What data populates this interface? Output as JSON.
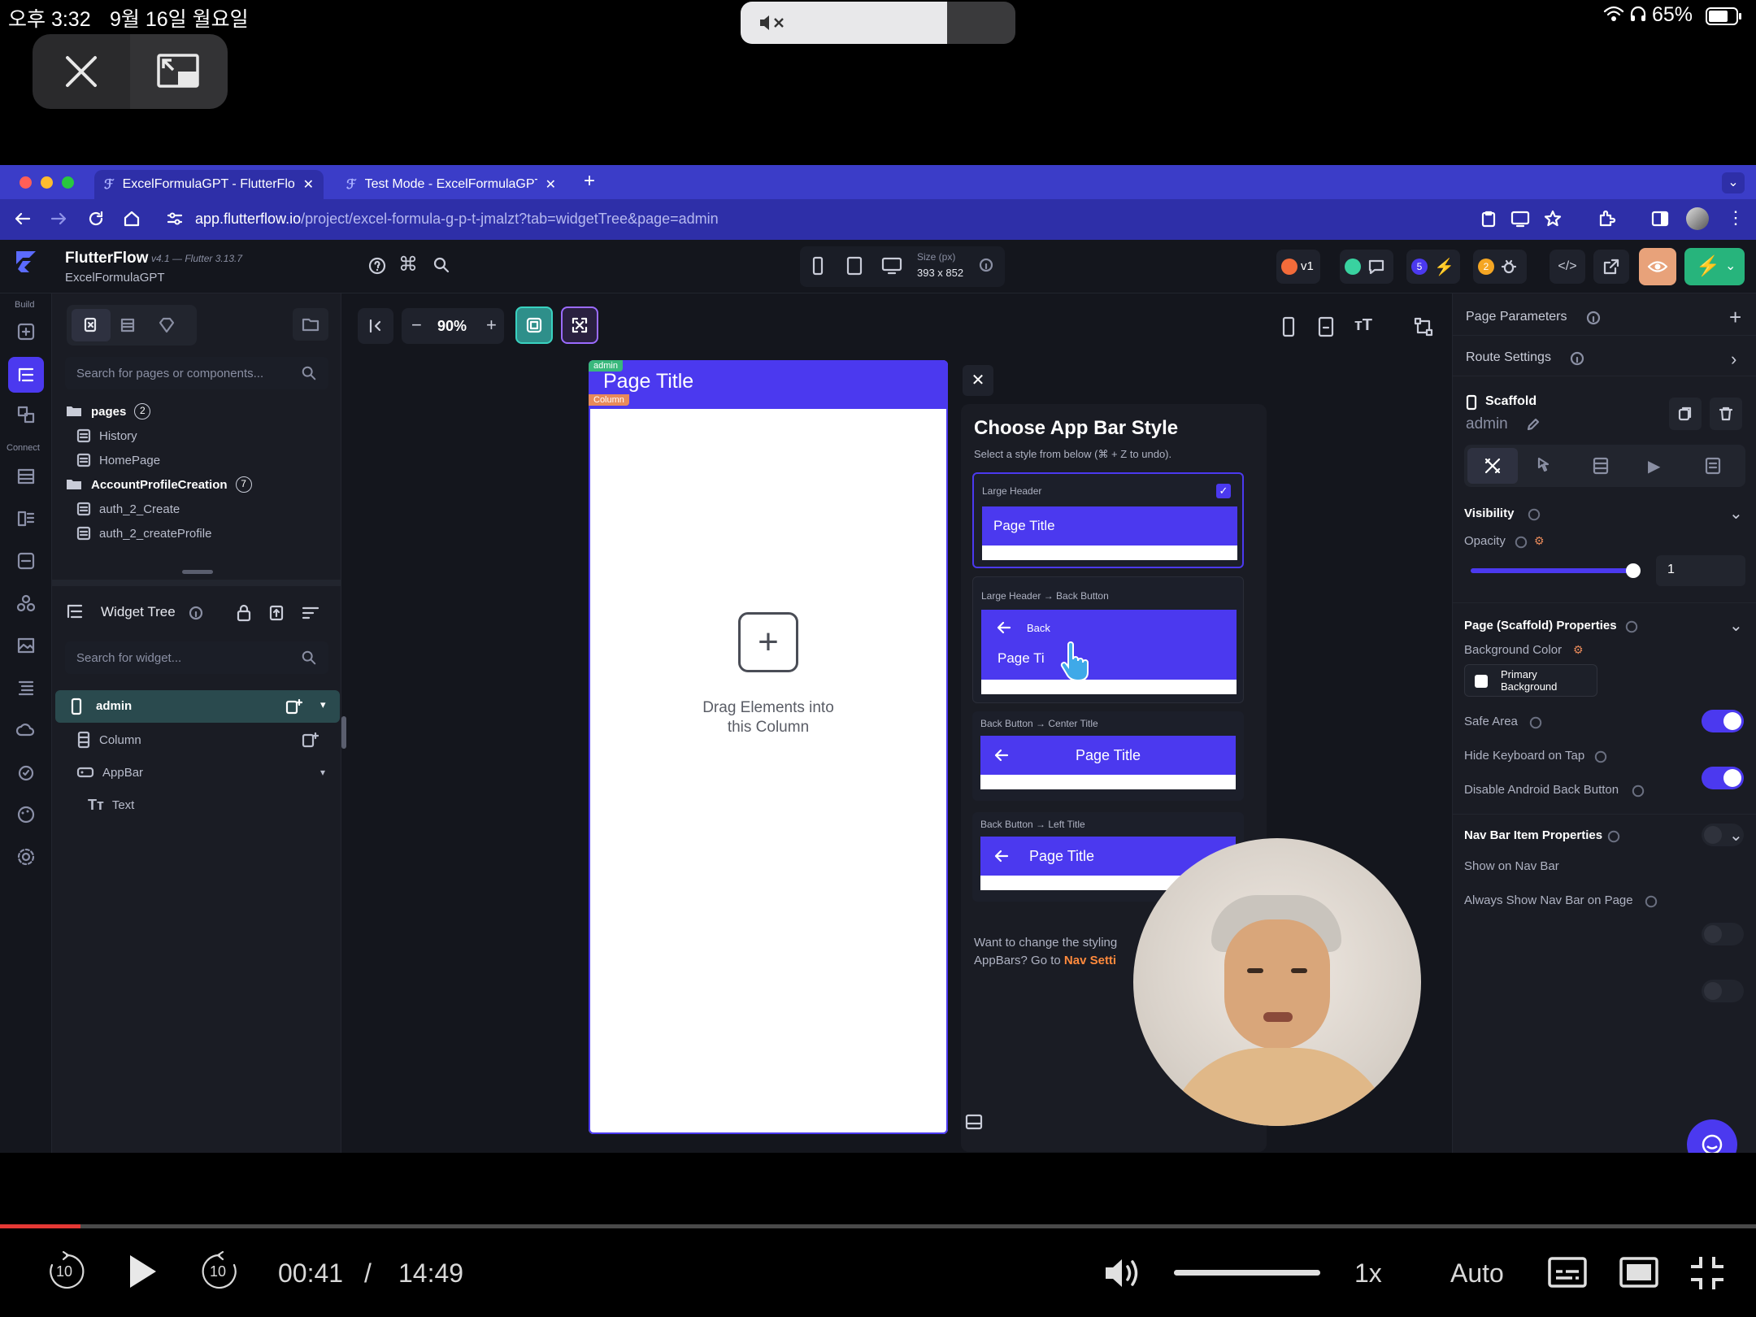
{
  "status": {
    "time": "오후 3:32",
    "date": "9월 16일 월요일",
    "battery": "65%"
  },
  "browser": {
    "tabs": [
      {
        "label": "ExcelFormulaGPT - FlutterFlow"
      },
      {
        "label": "Test Mode - ExcelFormulaGPT"
      }
    ],
    "url_host": "app.flutterflow.io",
    "url_path": "/project/excel-formula-g-p-t-jmalzt?tab=widgetTree&page=admin"
  },
  "app": {
    "name": "FlutterFlow",
    "version": "v4.1 — Flutter 3.13.7",
    "project": "ExcelFormulaGPT",
    "rail_build": "Build",
    "rail_connect": "Connect",
    "device_size_label": "Size (px)",
    "device_size": "393 x 852",
    "badges": {
      "version": "v1",
      "count_blue": "5",
      "count_orange": "2"
    }
  },
  "left": {
    "search_placeholder": "Search for pages or components...",
    "folders": [
      {
        "name": "pages",
        "count": "2",
        "items": [
          "History",
          "HomePage"
        ]
      },
      {
        "name": "AccountProfileCreation",
        "count": "7",
        "items": [
          "auth_2_Create",
          "auth_2_createProfile"
        ]
      }
    ],
    "widget_tree_title": "Widget Tree",
    "widget_search_placeholder": "Search for widget...",
    "tree": [
      {
        "label": "admin"
      },
      {
        "label": "Column"
      },
      {
        "label": "AppBar"
      },
      {
        "label": "Text"
      }
    ]
  },
  "canvas": {
    "zoom": "90%",
    "tag_page": "admin",
    "tag_column": "Column",
    "page_title": "Page Title",
    "drop_text_1": "Drag Elements into",
    "drop_text_2": "this Column"
  },
  "dialog": {
    "title": "Choose App Bar Style",
    "subtitle": "Select a style from below (⌘ + Z to undo).",
    "options": [
      {
        "label": "Large Header",
        "title": "Page Title"
      },
      {
        "label": "Large Header → Back Button",
        "back": "Back",
        "title": "Page Ti"
      },
      {
        "label": "Back Button → Center Title",
        "title": "Page Title"
      },
      {
        "label": "Back Button → Left Title",
        "title": "Page Title"
      }
    ],
    "footer_1": "Want to change the styling",
    "footer_2": "AppBars? Go to",
    "footer_link": "Nav Setti"
  },
  "right": {
    "page_parameters": "Page Parameters",
    "route_settings": "Route Settings",
    "widget_type": "Scaffold",
    "widget_name": "admin",
    "visibility": "Visibility",
    "opacity_label": "Opacity",
    "opacity_value": "1",
    "opacity_fraction": 1,
    "scaffold_props": "Page (Scaffold) Properties",
    "bg_color_label": "Background Color",
    "bg_color_value_1": "Primary",
    "bg_color_value_2": "Background",
    "safe_area": "Safe Area",
    "hide_keyboard": "Hide Keyboard on Tap",
    "disable_back": "Disable Android Back Button",
    "nav_bar_props": "Nav Bar Item Properties",
    "show_nav": "Show on Nav Bar",
    "always_show_nav": "Always Show Nav Bar on Page"
  },
  "player": {
    "current": "00:41",
    "separator": "/",
    "duration": "14:49",
    "progress_fraction": 0.046,
    "volume_fraction": 1,
    "speed": "1x",
    "quality": "Auto",
    "skip_back": "10",
    "skip_fwd": "10"
  },
  "colors": {
    "accent": "#4b39ef",
    "tabbar": "#3b3dc8",
    "progress": "#e53935",
    "link": "#ff8a3d"
  }
}
